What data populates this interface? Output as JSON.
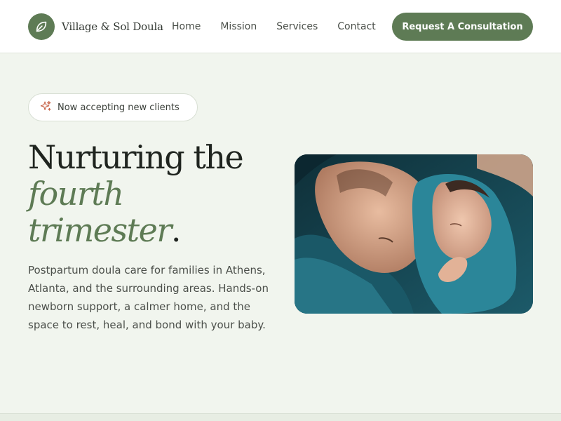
{
  "header": {
    "brand_name": "Village & Sol Doula",
    "logo_icon": "leaf-icon",
    "nav": [
      {
        "label": "Home"
      },
      {
        "label": "Mission"
      },
      {
        "label": "Services"
      },
      {
        "label": "Contact"
      }
    ],
    "cta_label": "Request A Consultation"
  },
  "hero": {
    "badge_icon": "sparkle-icon",
    "badge_text": "Now accepting new clients",
    "headline_line1": "Nurturing the",
    "headline_accent_line1": "fourth",
    "headline_accent_line2": "trimester",
    "headline_period": ".",
    "description": "Postpartum doula care for families in Athens, Atlanta, and the surrounding areas. Hands-on newborn support, a calmer home, and the space to rest, heal, and bond with your baby."
  },
  "colors": {
    "accent": "#5e7b55",
    "page_background": "#f1f5ee",
    "header_background": "#ffffff",
    "badge_icon": "#c8654a"
  }
}
